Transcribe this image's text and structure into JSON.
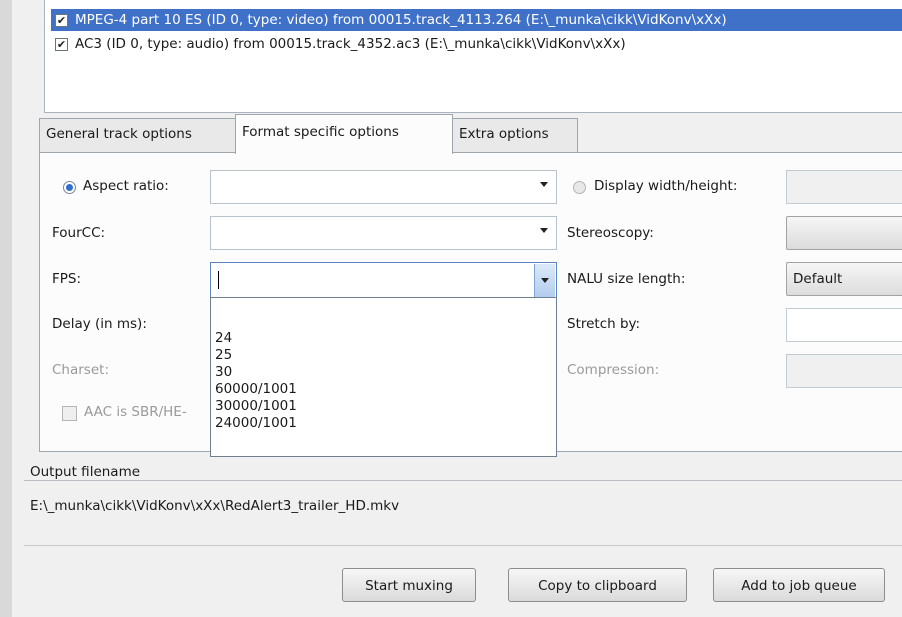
{
  "tracks": [
    {
      "label": "MPEG-4 part 10 ES (ID 0, type: video) from 00015.track_4113.264 (E:\\_munka\\cikk\\VidKonv\\xXx)",
      "checked": true,
      "selected": true
    },
    {
      "label": "AC3 (ID 0, type: audio) from 00015.track_4352.ac3 (E:\\_munka\\cikk\\VidKonv\\xXx)",
      "checked": true,
      "selected": false
    }
  ],
  "tabs": [
    {
      "label": "General track options",
      "active": false
    },
    {
      "label": "Format specific options",
      "active": true
    },
    {
      "label": "Extra options",
      "active": false
    }
  ],
  "form": {
    "aspect_ratio_label": "Aspect ratio:",
    "display_wh_label": "Display width/height:",
    "fourcc_label": "FourCC:",
    "stereoscopy_label": "Stereoscopy:",
    "fps_label": "FPS:",
    "fps_value": "",
    "nalu_label": "NALU size length:",
    "nalu_value": "Default",
    "delay_label": "Delay (in ms):",
    "stretch_label": "Stretch by:",
    "charset_label": "Charset:",
    "compression_label": "Compression:",
    "aac_label": "AAC is SBR/HE-"
  },
  "fps_options": [
    "",
    "24",
    "25",
    "30",
    "60000/1001",
    "30000/1001",
    "24000/1001"
  ],
  "output": {
    "group_label": "Output filename",
    "path": "E:\\_munka\\cikk\\VidKonv\\xXx\\RedAlert3_trailer_HD.mkv"
  },
  "buttons": {
    "start_muxing": "Start muxing",
    "copy_clipboard": "Copy to clipboard",
    "add_queue": "Add to job queue"
  },
  "colors": {
    "selection": "#3f71c9",
    "radio_dot": "#2f6fd0"
  }
}
